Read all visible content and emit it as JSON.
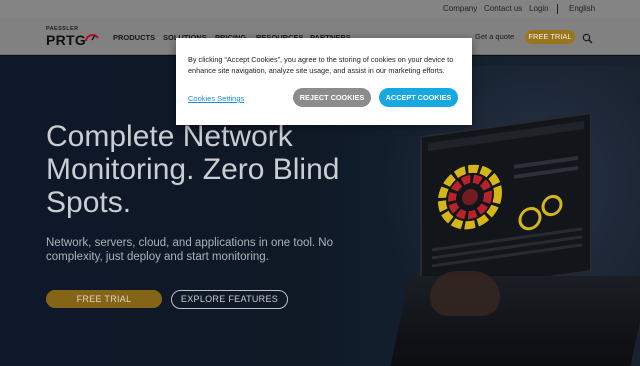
{
  "topbar": {
    "company": "Company",
    "contact": "Contact us",
    "login": "Login",
    "language": "English"
  },
  "brand": {
    "small": "PAESSLER",
    "big": "PRTG"
  },
  "nav": {
    "products": "PRODUCTS",
    "solutions": "SOLUTIONS",
    "pricing": "PRICING",
    "resources": "RESOURCES",
    "partners": "PARTNERS",
    "quote": "Get a quote",
    "trial": "FREE TRIAL",
    "search_icon": "search-icon"
  },
  "hero": {
    "headline": "Complete Network Monitoring. Zero Blind Spots.",
    "subline": "Network, servers, cloud, and applications in one tool. No complexity, just deploy and start monitoring.",
    "trial_button": "FREE TRIAL",
    "explore_button": "EXPLORE FEATURES"
  },
  "cookie": {
    "message": "By clicking “Accept Cookies”, you agree to the storing of cookies on your device to enhance site navigation, analyze site usage, and assist in our marketing efforts.",
    "settings": "Cookies Settings",
    "reject": "REJECT COOKIES",
    "accept": "ACCEPT COOKIES"
  },
  "colors": {
    "brand_gold": "#a57d1d",
    "accept_blue": "#16a8e0",
    "reject_gray": "#8c8c8c",
    "link_blue": "#1b8fd0"
  }
}
